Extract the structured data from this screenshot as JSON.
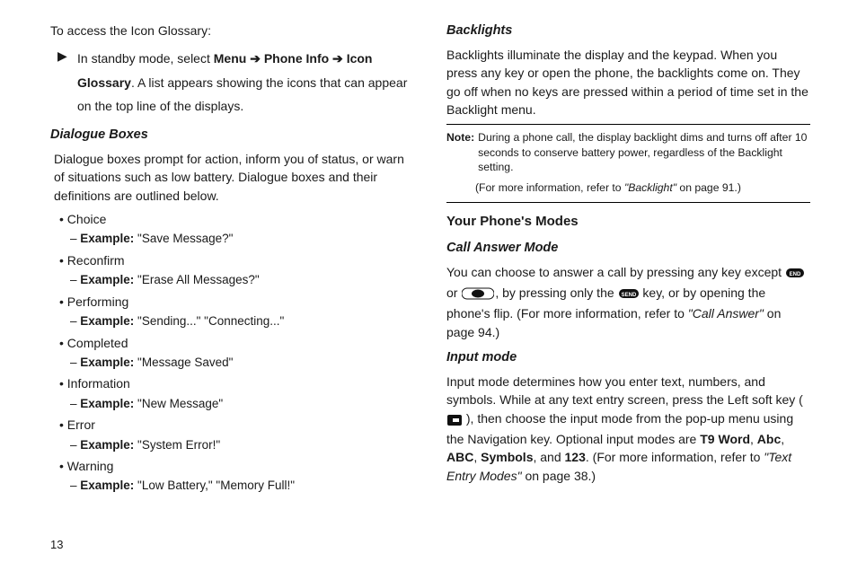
{
  "left": {
    "intro": "To access the Icon Glossary:",
    "step_pre": "In standby mode, select ",
    "step_menu": "Menu",
    "step_arrow": " ➔ ",
    "step_phone": "Phone Info",
    "step_icon": "Icon Glossary",
    "step_rest": ". A list appears showing the icons that can appear on the top line of the displays.",
    "dialog_head": "Dialogue Boxes",
    "dialog_body": "Dialogue boxes prompt for action, inform you of status, or warn of situations such as low battery. Dialogue boxes and their definitions are outlined below.",
    "items": [
      {
        "name": "Choice",
        "ex": "\"Save Message?\""
      },
      {
        "name": "Reconfirm",
        "ex": "\"Erase All Messages?\""
      },
      {
        "name": "Performing",
        "ex": "\"Sending...\" \"Connecting...\""
      },
      {
        "name": "Completed",
        "ex": "\"Message Saved\""
      },
      {
        "name": "Information",
        "ex": "\"New Message\""
      },
      {
        "name": "Error",
        "ex": "\"System Error!\""
      },
      {
        "name": "Warning",
        "ex": "\"Low Battery,\" \"Memory Full!\""
      }
    ],
    "ex_label": "Example: "
  },
  "right": {
    "backlights_head": "Backlights",
    "backlights_body": "Backlights illuminate the display and the keypad. When you press any key or open the phone, the backlights come on. They go off when no keys are pressed within a period of time set in the Backlight menu.",
    "note_label": "Note:",
    "note_body": "During a phone call, the display backlight dims and turns off after 10 seconds to conserve battery power, regardless of the Backlight setting.",
    "note_ref_pre": "(For more information, refer to ",
    "note_ref_it": "\"Backlight\"",
    "note_ref_post": "  on page 91.)",
    "modes_head": "Your Phone's Modes",
    "call_head": "Call Answer Mode",
    "call_a": "You can choose to answer a call by pressing any key except ",
    "call_b": " or ",
    "call_c": ", by pressing only the ",
    "call_d": " key, or by opening the phone's flip. (For more information, refer to ",
    "call_it": "\"Call Answer\"",
    "call_e": "  on page 94.)",
    "input_head": "Input mode",
    "input_a": "Input mode determines how you enter text, numbers, and symbols. While at any text entry screen, press the Left soft key ( ",
    "input_b": " ), then choose the input mode from the pop-up menu using the Navigation key. Optional input modes are ",
    "t9": "T9 Word",
    "abc1": "Abc",
    "abc2": "ABC",
    "sym": "Symbols",
    "and": ", and ",
    "num": "123",
    "input_c": ". (For more information, refer to ",
    "input_it": "\"Text Entry Modes\"",
    "input_d": "  on page 38.)"
  },
  "pagenum": "13"
}
